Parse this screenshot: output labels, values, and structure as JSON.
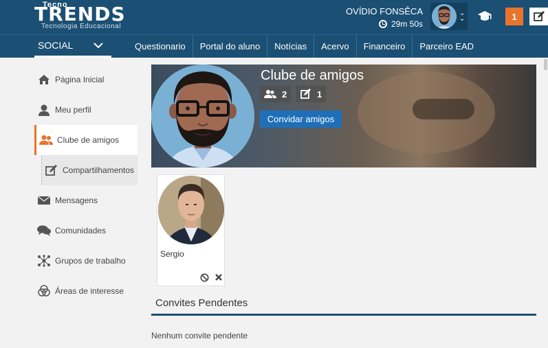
{
  "brand": {
    "logo_top": "Tecno",
    "logo_main": "TRENDS",
    "logo_sub": "Tecnologia Educacional"
  },
  "header": {
    "user_name": "OVÍDIO FONSÊCA",
    "timer": "29m 50s",
    "notifications_count": "1",
    "accent_color": "#e8732c",
    "bar_color": "#1b4f73"
  },
  "nav": {
    "social_label": "SOCIAL",
    "items": [
      "Questionario",
      "Portal do aluno",
      "Notícias",
      "Acervo",
      "Financeiro",
      "Parceiro EAD"
    ]
  },
  "sidebar": {
    "items": [
      {
        "label": "Página Inicial",
        "icon": "home-icon"
      },
      {
        "label": "Meu perfil",
        "icon": "user-icon"
      },
      {
        "label": "Clube de amigos",
        "icon": "users-icon"
      },
      {
        "label": "Compartilhamentos",
        "icon": "edit-icon"
      },
      {
        "label": "Mensagens",
        "icon": "envelope-icon"
      },
      {
        "label": "Comunidades",
        "icon": "comments-icon"
      },
      {
        "label": "Grupos de trabalho",
        "icon": "network-icon"
      },
      {
        "label": "Áreas de interesse",
        "icon": "circles-icon"
      }
    ]
  },
  "club": {
    "title": "Clube de amigos",
    "friends_count": "2",
    "shares_count": "1",
    "invite_label": "Convidar amigos"
  },
  "friends": [
    {
      "name": "Sergio"
    }
  ],
  "pending": {
    "title": "Convites Pendentes",
    "empty_text": "Nenhum convite pendente"
  }
}
